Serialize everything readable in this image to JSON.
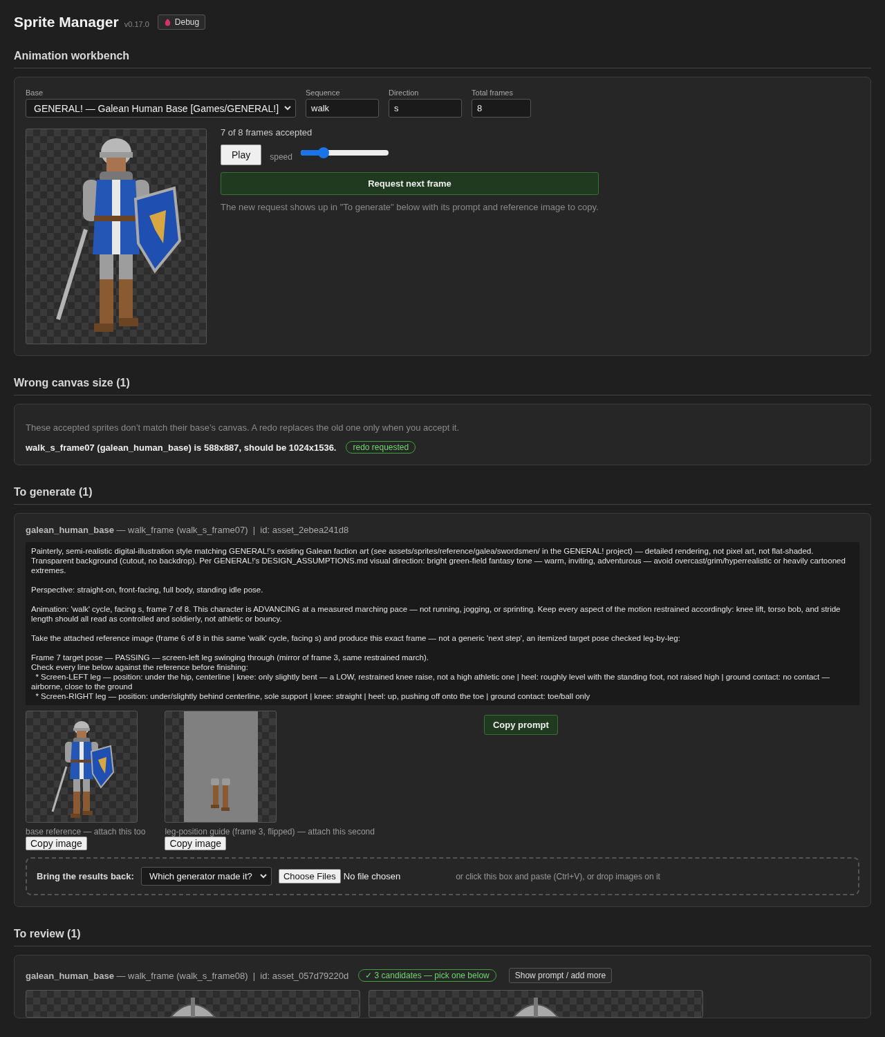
{
  "header": {
    "title": "Sprite Manager",
    "version": "v0.17.0",
    "debug_button": "Debug"
  },
  "workbench": {
    "heading": "Animation workbench",
    "fields": [
      {
        "kind": "select",
        "label": "Base",
        "value": "GENERAL! — Galean Human Base [Games/GENERAL!]"
      },
      {
        "kind": "text",
        "label": "Sequence",
        "value": "walk"
      },
      {
        "kind": "text",
        "label": "Direction",
        "value": "s"
      },
      {
        "kind": "text",
        "label": "Total frames",
        "value": "8"
      }
    ],
    "status": "7 of 8 frames accepted",
    "play_button": "Play",
    "speed_label": "speed",
    "speed": {
      "level": 0.26
    },
    "request_button": "Request next frame",
    "hint": "The new request shows up in \"To generate\" below with its prompt and reference image to copy."
  },
  "wrong_canvas": {
    "heading": "Wrong canvas size (1)",
    "intro": "These accepted sprites don’t match their base’s canvas. A redo replaces the old one only when you accept it.",
    "items": [
      {
        "text": "**walk_s_frame07 (galean_human_base) is 588x887, should be 1024x1536.**",
        "badge": "redo requested"
      }
    ]
  },
  "to_generate": {
    "heading": "To generate (1)",
    "items": [
      {
        "base": "galean_human_base",
        "meta": " — walk_frame (walk_s_frame07)  |  id: asset_2ebea241d8",
        "prompt": "Painterly, semi-realistic digital-illustration style matching GENERAL!'s existing Galean faction art (see assets/sprites/reference/galea/swordsmen/ in the GENERAL! project) — detailed rendering, not pixel art, not flat-shaded. Transparent background (cutout, no backdrop). Per GENERAL!'s DESIGN_ASSUMPTIONS.md visual direction: bright green-field fantasy tone — warm, inviting, adventurous — avoid overcast/grim/hyperrealistic or heavily cartooned extremes.\n\nPerspective: straight-on, front-facing, full body, standing idle pose.\n\nAnimation: 'walk' cycle, facing s, frame 7 of 8. This character is ADVANCING at a measured marching pace — not running, jogging, or sprinting. Keep every aspect of the motion restrained accordingly: knee lift, torso bob, and stride length should all read as controlled and soldierly, not athletic or bouncy.\n\nTake the attached reference image (frame 6 of 8 in this same 'walk' cycle, facing s) and produce this exact frame — not a generic 'next step', an itemized target pose checked leg-by-leg:\n\nFrame 7 target pose — PASSING — screen-left leg swinging through (mirror of frame 3, same restrained march).\nCheck every line below against the reference before finishing:\n  * Screen-LEFT leg — position: under the hip, centerline | knee: only slightly bent — a LOW, restrained knee raise, not a high athletic one | heel: roughly level with the standing foot, not raised high | ground contact: no contact — airborne, close to the ground\n  * Screen-RIGHT leg — position: under/slightly behind centerline, sole support | knee: straight | heel: up, pushing off onto the toe | ground contact: toe/ball only",
        "copy_prompt": "Copy prompt",
        "references": [
          {
            "kind": "full",
            "caption": "base reference — attach this too",
            "button": "Copy image"
          },
          {
            "kind": "legs",
            "caption": "leg-position guide (frame 3, flipped) — attach this second",
            "button": "Copy image"
          }
        ],
        "upload": {
          "label": "Bring the results back:",
          "select": "Which generator made it?",
          "file_button": "Choose Files",
          "file_status": "No file chosen",
          "hint": "or click this box and paste (Ctrl+V), or drop images on it"
        }
      }
    ]
  },
  "to_review": {
    "heading": "To review (1)",
    "items": [
      {
        "base": "galean_human_base",
        "meta": " — walk_frame (walk_s_frame08)  |  id: asset_057d79220d",
        "badge": "✓ 3 candidates — pick one below",
        "button": "Show prompt / add more",
        "candidate_images": [
          {
            "kind": "sprite"
          },
          {
            "kind": "sprite"
          }
        ]
      }
    ]
  }
}
